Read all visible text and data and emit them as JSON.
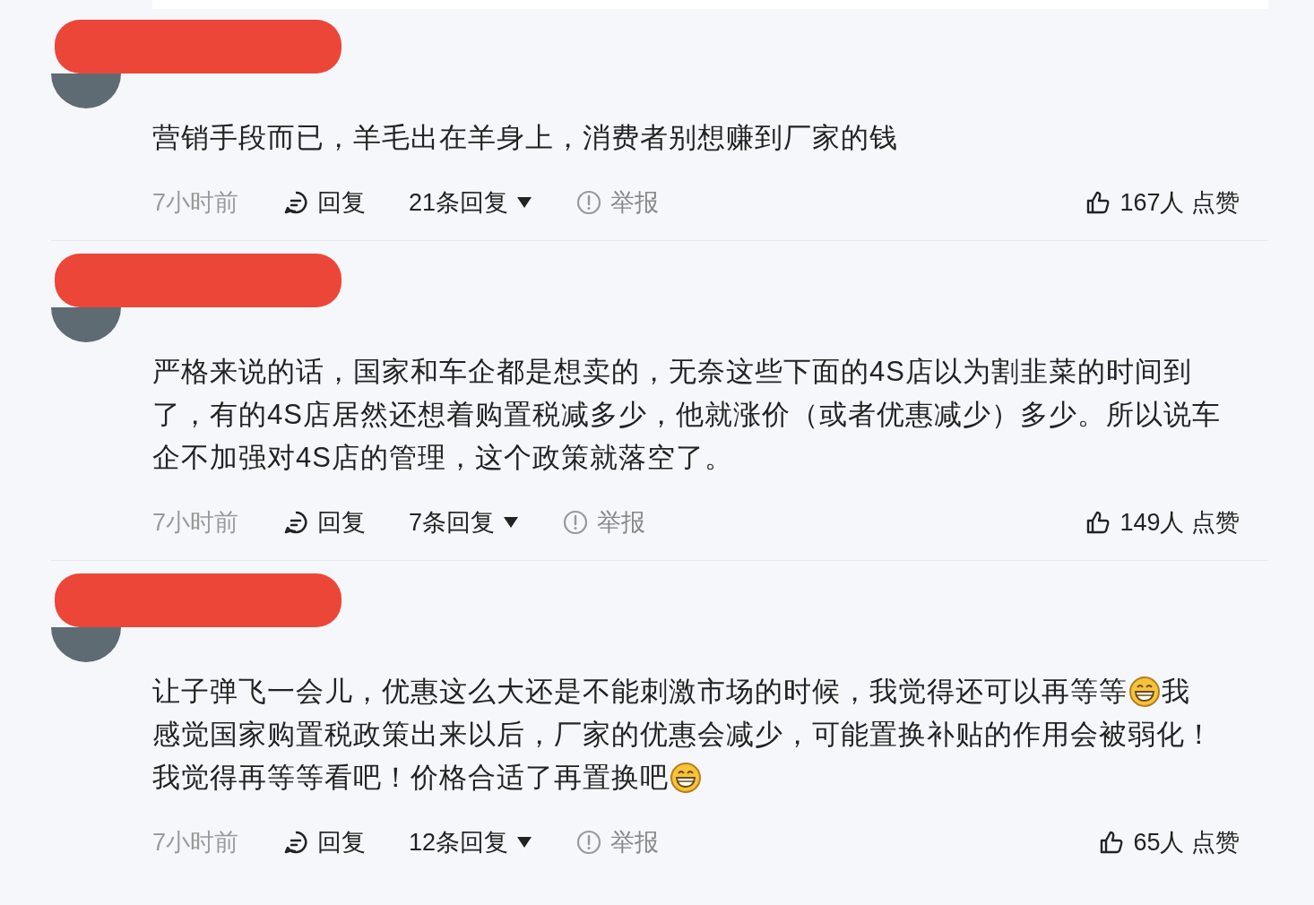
{
  "comments": [
    {
      "lines": [
        [
          {
            "kind": "text",
            "text": "营销手段而已，羊毛出在羊身上，消费者别想赚到厂家的钱"
          }
        ]
      ],
      "time": "7小时前",
      "reply": "回复",
      "replies": "21条回复",
      "report": "举报",
      "likes": "167人 点赞"
    },
    {
      "lines": [
        [
          {
            "kind": "text",
            "text": "严格来说的话，国家和车企都是想卖的，无奈这些下面的4S店以为割韭菜的时间到"
          }
        ],
        [
          {
            "kind": "text",
            "text": "了，有的4S店居然还想着购置税减多少，他就涨价（或者优惠减少）多少。所以说车"
          }
        ],
        [
          {
            "kind": "text",
            "text": "企不加强对4S店的管理，这个政策就落空了。"
          }
        ]
      ],
      "time": "7小时前",
      "reply": "回复",
      "replies": "7条回复",
      "report": "举报",
      "likes": "149人 点赞"
    },
    {
      "lines": [
        [
          {
            "kind": "text",
            "text": "让子弹飞一会儿，优惠这么大还是不能刺激市场的时候，我觉得还可以再等等"
          },
          {
            "kind": "emoji"
          },
          {
            "kind": "text",
            "text": "我"
          }
        ],
        [
          {
            "kind": "text",
            "text": "感觉国家购置税政策出来以后，厂家的优惠会减少，可能置换补贴的作用会被弱化！"
          }
        ],
        [
          {
            "kind": "text",
            "text": "我觉得再等等看吧！价格合适了再置换吧"
          },
          {
            "kind": "emoji"
          }
        ]
      ],
      "time": "7小时前",
      "reply": "回复",
      "replies": "12条回复",
      "report": "举报",
      "likes": "65人 点赞"
    }
  ]
}
